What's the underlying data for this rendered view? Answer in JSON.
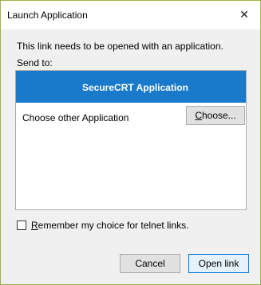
{
  "window": {
    "title": "Launch Application",
    "close_glyph": "✕"
  },
  "dialog": {
    "message": "This link needs to be opened with an application.",
    "send_to_label": "Send to:",
    "apps": [
      {
        "label": "SecureCRT Application",
        "selected": true
      },
      {
        "label": "Choose other Application",
        "selected": false
      }
    ],
    "choose_button": {
      "mnemonic": "C",
      "rest": "hoose..."
    },
    "remember": {
      "checked": false,
      "mnemonic": "R",
      "rest": "emember my choice for telnet links."
    },
    "cancel_label": "Cancel",
    "open_label": "Open link"
  },
  "colors": {
    "selection": "#1979ca",
    "accent_border": "#9bb347"
  }
}
